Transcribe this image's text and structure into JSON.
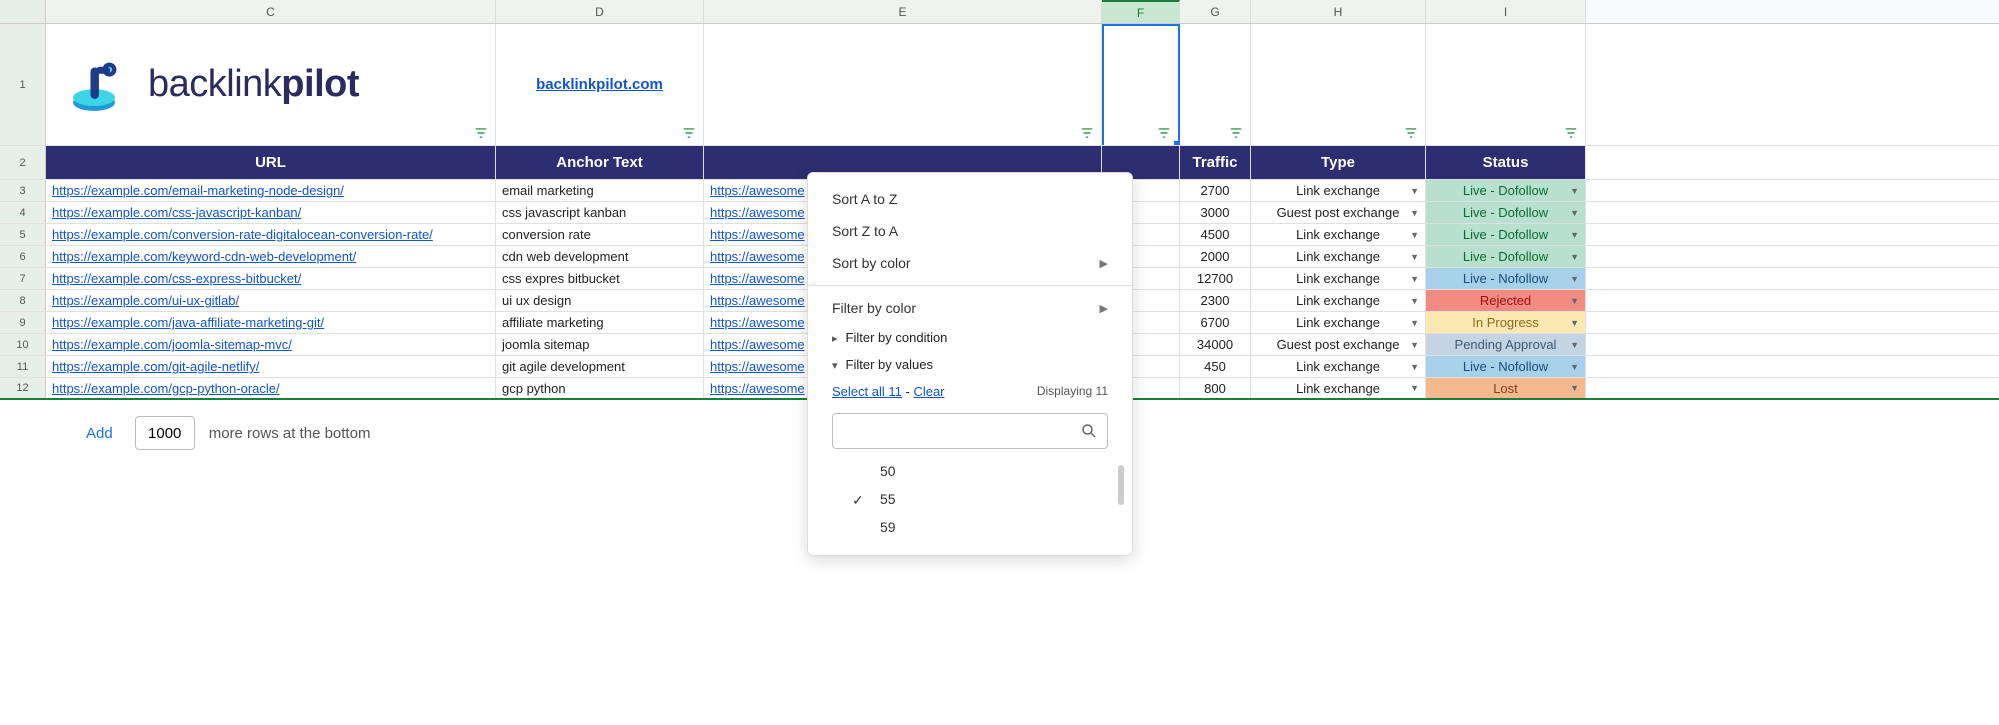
{
  "columns": [
    "C",
    "D",
    "E",
    "F",
    "G",
    "H",
    "I"
  ],
  "logo": {
    "brand_normal": "backlink",
    "brand_bold": "pilot",
    "domain": "backlinkpilot.com"
  },
  "headers": {
    "c": "URL",
    "d": "Anchor Text",
    "g": "Traffic",
    "h": "Type",
    "i": "Status"
  },
  "rows": [
    {
      "url": "https://example.com/email-marketing-node-design/",
      "anchor": "email marketing",
      "target": "https://awesome",
      "traffic": "2700",
      "type": "Link exchange",
      "status": "Live - Dofollow",
      "status_class": "status-live-dofollow"
    },
    {
      "url": "https://example.com/css-javascript-kanban/",
      "anchor": "css javascript kanban",
      "target": "https://awesome",
      "traffic": "3000",
      "type": "Guest post exchange",
      "status": "Live - Dofollow",
      "status_class": "status-live-dofollow"
    },
    {
      "url": "https://example.com/conversion-rate-digitalocean-conversion-rate/",
      "anchor": "conversion rate",
      "target": "https://awesome",
      "traffic": "4500",
      "type": "Link exchange",
      "status": "Live - Dofollow",
      "status_class": "status-live-dofollow"
    },
    {
      "url": "https://example.com/keyword-cdn-web-development/",
      "anchor": "cdn web development",
      "target": "https://awesome",
      "traffic": "2000",
      "type": "Link exchange",
      "status": "Live - Dofollow",
      "status_class": "status-live-dofollow"
    },
    {
      "url": "https://example.com/css-express-bitbucket/",
      "anchor": "css expres bitbucket",
      "target": "https://awesome",
      "traffic": "12700",
      "type": "Link exchange",
      "status": "Live - Nofollow",
      "status_class": "status-live-nofollow"
    },
    {
      "url": "https://example.com/ui-ux-gitlab/",
      "anchor": "ui ux design",
      "target": "https://awesome",
      "traffic": "2300",
      "type": "Link exchange",
      "status": "Rejected",
      "status_class": "status-rejected"
    },
    {
      "url": "https://example.com/java-affiliate-marketing-git/",
      "anchor": "affiliate marketing",
      "target": "https://awesome",
      "traffic": "6700",
      "type": "Link exchange",
      "status": "In Progress",
      "status_class": "status-inprogress"
    },
    {
      "url": "https://example.com/joomla-sitemap-mvc/",
      "anchor": "joomla sitemap",
      "target": "https://awesome",
      "traffic": "34000",
      "type": "Guest post exchange",
      "status": "Pending Approval",
      "status_class": "status-pending"
    },
    {
      "url": "https://example.com/git-agile-netlify/",
      "anchor": "git agile development",
      "target": "https://awesome",
      "traffic": "450",
      "type": "Link exchange",
      "status": "Live - Nofollow",
      "status_class": "status-live-nofollow"
    },
    {
      "url": "https://example.com/gcp-python-oracle/",
      "anchor": "gcp python",
      "target": "https://awesome",
      "traffic": "800",
      "type": "Link exchange",
      "status": "Lost",
      "status_class": "status-lost"
    }
  ],
  "filter_popup": {
    "sort_az": "Sort A to Z",
    "sort_za": "Sort Z to A",
    "sort_color": "Sort by color",
    "filter_color": "Filter by color",
    "filter_cond": "Filter by condition",
    "filter_vals": "Filter by values",
    "select_all": "Select all 11",
    "clear": "Clear",
    "displaying": "Displaying 11",
    "values": [
      {
        "val": "50",
        "checked": false
      },
      {
        "val": "55",
        "checked": true
      },
      {
        "val": "59",
        "checked": false
      }
    ]
  },
  "footer": {
    "add": "Add",
    "count": "1000",
    "more": "more rows at the bottom"
  },
  "row_numbers": [
    "1",
    "2",
    "3",
    "4",
    "5",
    "6",
    "7",
    "8",
    "9",
    "10",
    "11",
    "12"
  ]
}
